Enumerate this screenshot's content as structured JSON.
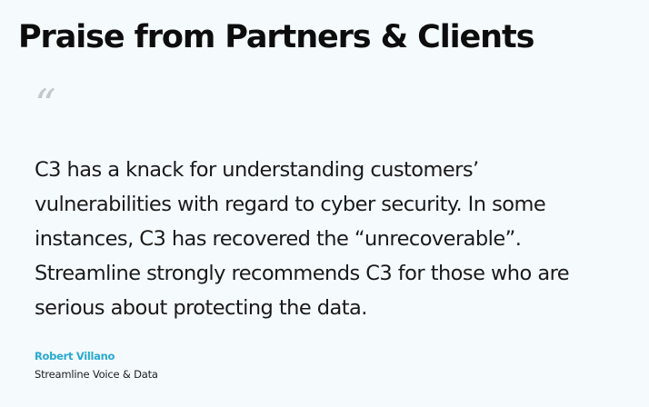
{
  "section": {
    "heading": "Praise from Partners & Clients"
  },
  "testimonial": {
    "quote_mark": "“",
    "quote_lines": [
      "C3 has a knack for understanding customers’",
      "vulnerabilities with regard to cyber security. In some",
      "instances, C3 has recovered the “unrecoverable”.",
      "Streamline strongly recommends C3 for those who are",
      "serious about protecting the data."
    ],
    "author_name": "Robert Villano",
    "author_company": "Streamline Voice & Data"
  },
  "colors": {
    "background": "#f5fbfd",
    "accent": "#28a9d2",
    "quote_mark": "#c4c8cb"
  }
}
